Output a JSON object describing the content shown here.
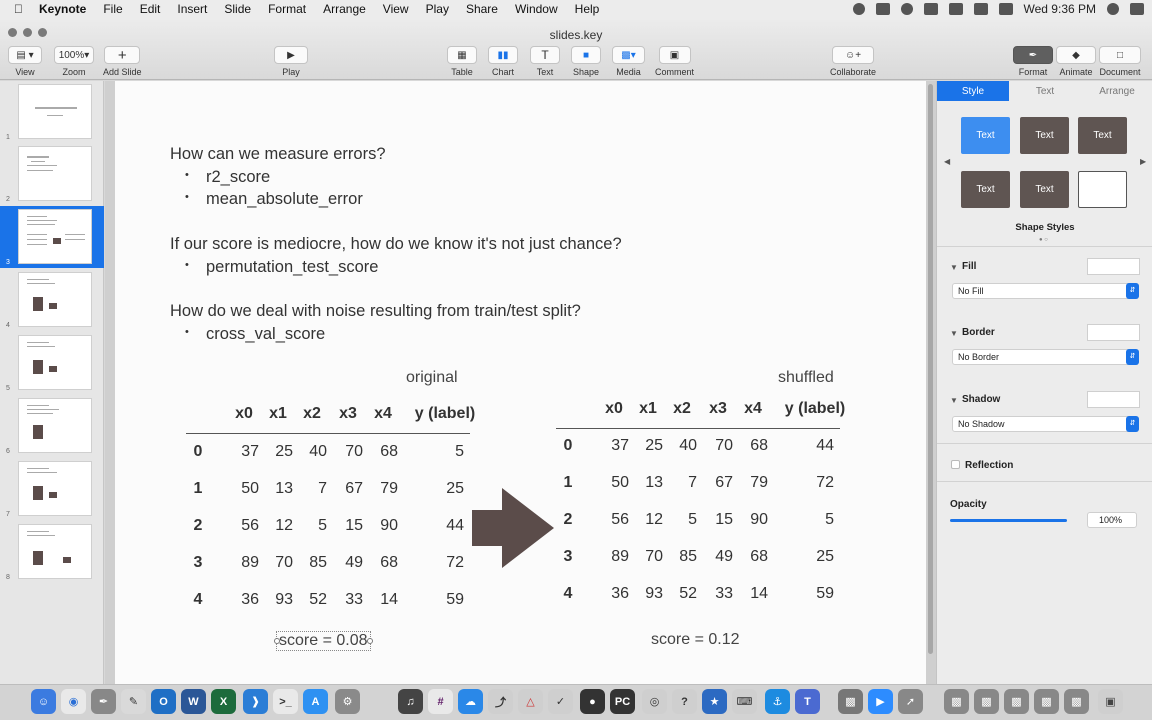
{
  "menubar": {
    "apple": "",
    "items": [
      "Keynote",
      "File",
      "Edit",
      "Insert",
      "Slide",
      "Format",
      "Arrange",
      "View",
      "Play",
      "Share",
      "Window",
      "Help"
    ],
    "clock": "Wed 9:36 PM"
  },
  "window": {
    "title": "slides.key"
  },
  "toolbar": {
    "view_label": "View",
    "zoom_label": "Zoom",
    "zoom_value": "100%",
    "add_slide_label": "Add Slide",
    "play_label": "Play",
    "table_label": "Table",
    "chart_label": "Chart",
    "text_label": "Text",
    "shape_label": "Shape",
    "media_label": "Media",
    "comment_label": "Comment",
    "collaborate_label": "Collaborate",
    "format_label": "Format",
    "animate_label": "Animate",
    "document_label": "Document"
  },
  "navigator": {
    "slides": [
      "1",
      "2",
      "3",
      "4",
      "5",
      "6",
      "7",
      "8"
    ],
    "selected": "3"
  },
  "slide": {
    "q1": "How can we measure errors?",
    "q1_bullets": [
      "r2_score",
      "mean_absolute_error"
    ],
    "q2": "If our score is mediocre, how do we know it's not just chance?",
    "q2_bullets": [
      "permutation_test_score"
    ],
    "q3": "How do we deal with noise resulting from train/test split?",
    "q3_bullets": [
      "cross_val_score"
    ],
    "original_caption": "original",
    "shuffled_caption": "shuffled",
    "columns": [
      "x0",
      "x1",
      "x2",
      "x3",
      "x4",
      "y (label)"
    ],
    "original_rows": [
      [
        "0",
        "37",
        "25",
        "40",
        "70",
        "68",
        "5"
      ],
      [
        "1",
        "50",
        "13",
        "7",
        "67",
        "79",
        "25"
      ],
      [
        "2",
        "56",
        "12",
        "5",
        "15",
        "90",
        "44"
      ],
      [
        "3",
        "89",
        "70",
        "85",
        "49",
        "68",
        "72"
      ],
      [
        "4",
        "36",
        "93",
        "52",
        "33",
        "14",
        "59"
      ]
    ],
    "shuffled_rows": [
      [
        "0",
        "37",
        "25",
        "40",
        "70",
        "68",
        "44"
      ],
      [
        "1",
        "50",
        "13",
        "7",
        "67",
        "79",
        "72"
      ],
      [
        "2",
        "56",
        "12",
        "5",
        "15",
        "90",
        "5"
      ],
      [
        "3",
        "89",
        "70",
        "85",
        "49",
        "68",
        "25"
      ],
      [
        "4",
        "36",
        "93",
        "52",
        "33",
        "14",
        "59"
      ]
    ],
    "original_score": "score = 0.08",
    "shuffled_score": "score = 0.12",
    "arrow_color": "#5b4c4a"
  },
  "inspector": {
    "tabs": [
      "Style",
      "Text",
      "Arrange"
    ],
    "active_tab": "Style",
    "swatch_text": "Text",
    "shape_styles_label": "Shape Styles",
    "fill_label": "Fill",
    "fill_value": "No Fill",
    "border_label": "Border",
    "border_value": "No Border",
    "shadow_label": "Shadow",
    "shadow_value": "No Shadow",
    "reflection_label": "Reflection",
    "opacity_label": "Opacity",
    "opacity_value": "100%",
    "accent": "#1a73e8"
  }
}
